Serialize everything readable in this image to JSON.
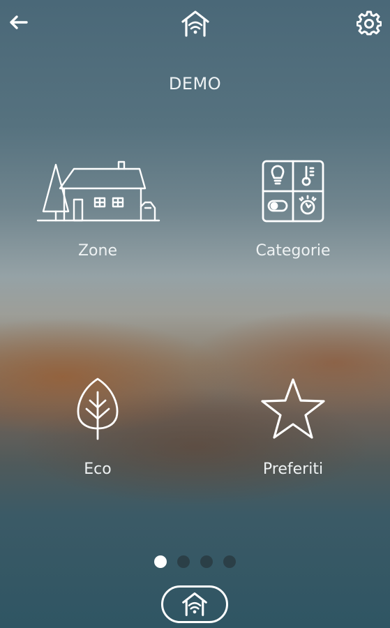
{
  "header": {
    "back_icon": "arrow-left-icon",
    "logo_icon": "home-wifi-icon",
    "settings_icon": "gear-icon"
  },
  "title": "DEMO",
  "tiles": [
    {
      "label": "Zone",
      "icon": "house-icon"
    },
    {
      "label": "Categorie",
      "icon": "categories-grid-icon"
    },
    {
      "label": "Eco",
      "icon": "leaf-icon"
    },
    {
      "label": "Preferiti",
      "icon": "star-icon"
    }
  ],
  "pager": {
    "total": 4,
    "active": 1
  },
  "footer": {
    "home_icon": "home-wifi-icon"
  },
  "colors": {
    "foreground": "#ffffff",
    "inactive_dot": "#283740"
  }
}
